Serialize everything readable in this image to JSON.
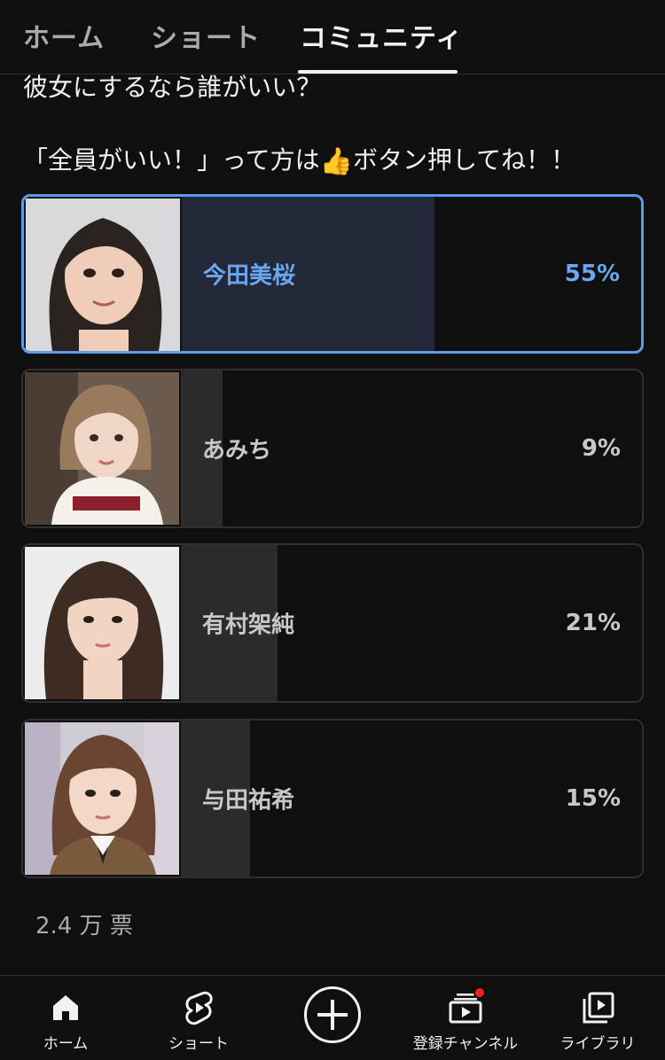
{
  "tabs": [
    {
      "label": "ホーム"
    },
    {
      "label": "ショート"
    },
    {
      "label": "コミュニティ",
      "active": true
    }
  ],
  "post": {
    "line1": "彼女にするなら誰がいい？",
    "line2_before": "「全員がいい！」って方は",
    "line2_after": "ボタン押してね！！",
    "emoji": "👍"
  },
  "poll": {
    "options": [
      {
        "name": "今田美桜",
        "percent_label": "55%",
        "percent": 55,
        "selected": true
      },
      {
        "name": "あみち",
        "percent_label": "9%",
        "percent": 9,
        "selected": false
      },
      {
        "name": "有村架純",
        "percent_label": "21%",
        "percent": 21,
        "selected": false
      },
      {
        "name": "与田祐希",
        "percent_label": "15%",
        "percent": 15,
        "selected": false
      }
    ],
    "votes_label": "2.4 万 票"
  },
  "bottom_nav": [
    {
      "label": "ホーム",
      "icon": "home-icon"
    },
    {
      "label": "ショート",
      "icon": "shorts-icon"
    },
    {
      "label": "",
      "icon": "create-icon"
    },
    {
      "label": "登録チャンネル",
      "icon": "subscriptions-icon"
    },
    {
      "label": "ライブラリ",
      "icon": "library-icon"
    }
  ],
  "colors": {
    "background": "#0f0f0f",
    "accent_blue": "#6aa7f2",
    "notification_dot": "#e22222"
  }
}
